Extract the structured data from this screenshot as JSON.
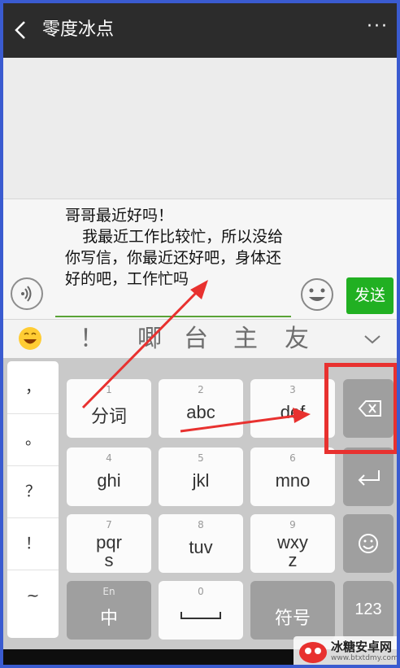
{
  "header": {
    "title": "零度冰点",
    "more": "···"
  },
  "input": {
    "text": "哥哥最近好吗！\n    我最近工作比较忙，所以没给你写信，你最近还好吧，身体还好的吧，工作忙吗",
    "send_label": "发送"
  },
  "ime": {
    "candidates": [
      "！",
      "唧",
      "台",
      "主",
      "友"
    ]
  },
  "keyboard": {
    "symbols": [
      "，",
      "。",
      "？",
      "！",
      "~"
    ],
    "keys": [
      {
        "sub": "1",
        "main": "分词"
      },
      {
        "sub": "2",
        "main": "abc"
      },
      {
        "sub": "3",
        "main": "def"
      },
      {
        "sub": "4",
        "main": "ghi"
      },
      {
        "sub": "5",
        "main": "jkl"
      },
      {
        "sub": "6",
        "main": "mno"
      },
      {
        "sub": "7",
        "main": "pqr\ns"
      },
      {
        "sub": "8",
        "main": "tuv"
      },
      {
        "sub": "9",
        "main": "wxy\nz"
      },
      {
        "sub": "En",
        "main": "中"
      },
      {
        "sub": "0",
        "main": ""
      },
      {
        "sub": "",
        "main": "符号"
      },
      {
        "sub": "",
        "main": "123"
      }
    ]
  },
  "watermark": {
    "title": "冰糖安卓网",
    "url": "www.btxtdmy.com"
  },
  "colors": {
    "send_bg": "#21b022",
    "annotation": "#e8312f",
    "header_bg": "#2c2c2c"
  },
  "icons": [
    "back-arrow-icon",
    "more-icon",
    "voice-icon",
    "smiley-icon",
    "emoji-icon",
    "chevron-down-icon",
    "backspace-icon",
    "enter-icon",
    "face-icon"
  ]
}
